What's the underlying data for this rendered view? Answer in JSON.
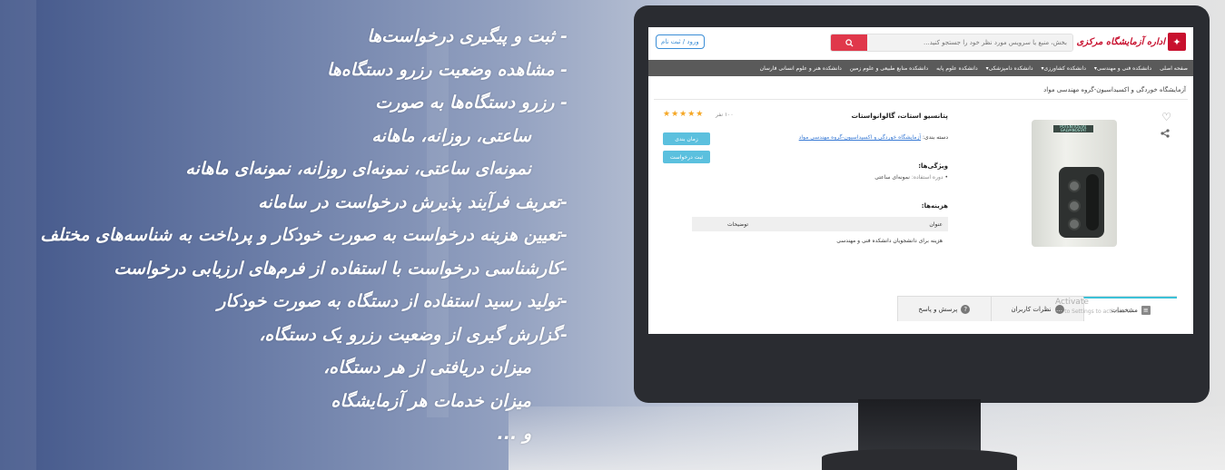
{
  "features": [
    "- ثبت و پیگیری درخواست‌ها",
    "- مشاهده وضعیت رزرو دستگاه‌ها",
    "- رزرو دستگاه‌ها به صورت",
    "ساعتی، روزانه، ماهانه",
    "نمونه‌ای ساعتی، نمونه‌ای روزانه، نمونه‌ای ماهانه",
    "-تعریف فرآیند پذیرش درخواست در سامانه",
    "-تعیین هزینه درخواست به صورت خودکار و پرداخت به شناسه‌های مختلف",
    "-کارشناسی درخواست با استفاده از فرم‌های ارزیابی درخواست",
    "-تولید رسید استفاده از دستگاه به صورت خودکار",
    "-گزارش گیری از وضعیت رزرو یک دستگاه،",
    "میزان دریافتی از هر دستگاه،",
    "میزان خدمات هر آزمایشگاه",
    "و ..."
  ],
  "site": {
    "logo_text": "اداره آزمایشگاه مرکزی",
    "search_placeholder": "بخش، منبع یا سرویس مورد نظر خود را جستجو کنید...",
    "login_label": "ورود / ثبت نام",
    "nav": [
      "صفحه اصلی",
      "دانشکده فنی و مهندسی▾",
      "دانشکده کشاورزی▾",
      "دانشکده دامپزشکی▾",
      "دانشکده علوم پایه",
      "دانشکده منابع طبیعی و علوم زمین",
      "دانشکده هنر و علوم انسانی فارسان"
    ],
    "breadcrumb": "آزمایشگاه خوردگی و اکسیداسیون-گروه مهندسی مواد"
  },
  "product": {
    "title": "پتانسیو استات، گالوانواستات",
    "rating_count": "۱۰۰ نفر",
    "stars": "★★★★★",
    "category_label": "دسته بندی:",
    "category_value": "آزمایشگاه خوردگی و اکسیداسیون-گروه مهندسی مواد",
    "reserve_button": "زمان بندی",
    "request_button": "ثبت درخواست",
    "features_heading": "ویژگی‌ها:",
    "feature_key": "دوره استفاده:",
    "feature_value": "نمونه‌ای ساعتی",
    "costs_heading": "هزینه‌ها:",
    "cost_col_title": "عنوان",
    "cost_col_desc": "توضیحات",
    "cost_row": "هزینه برای دانشجویان دانشکده فنی و مهندسی",
    "device_label": "POTENTIOSTAT GALVANOSTAT"
  },
  "tabs": [
    {
      "label": "مشخصات",
      "icon": "list-icon"
    },
    {
      "label": "نظرات کاربران",
      "icon": "comments-icon"
    },
    {
      "label": "پرسش و پاسخ",
      "icon": "question-icon"
    }
  ],
  "watermark": {
    "line1": "Activate",
    "line2": "Go to Settings to activate W"
  }
}
